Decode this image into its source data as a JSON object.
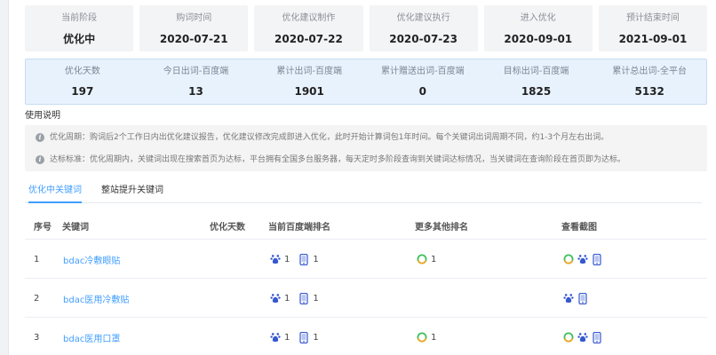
{
  "stages": [
    {
      "label": "当前阶段",
      "value": "优化中"
    },
    {
      "label": "购词时间",
      "value": "2020-07-21"
    },
    {
      "label": "优化建议制作",
      "value": "2020-07-22"
    },
    {
      "label": "优化建议执行",
      "value": "2020-07-23"
    },
    {
      "label": "进入优化",
      "value": "2020-09-01"
    },
    {
      "label": "预计结束时间",
      "value": "2021-09-01"
    }
  ],
  "stats": [
    {
      "label": "优化天数",
      "value": "197"
    },
    {
      "label": "今日出词-百度端",
      "value": "13"
    },
    {
      "label": "累计出词-百度端",
      "value": "1901"
    },
    {
      "label": "累计赠送出词-百度端",
      "value": "0"
    },
    {
      "label": "目标出词-百度端",
      "value": "1825"
    },
    {
      "label": "累计总出词-全平台",
      "value": "5132"
    }
  ],
  "usage": {
    "title": "使用说明",
    "notes": [
      "优化周期：购词后2个工作日内出优化建议报告，优化建议修改完成即进入优化，此时开始计算词包1年时间。每个关键词出词周期不同，约1-3个月左右出词。",
      "达标标准：优化周期内，关键词出现在搜索首页为达标，平台拥有全国多台服务器，每天定时多阶段查询到关键词达标情况，当关键词在查询阶段在首页即为达标。"
    ]
  },
  "tabs": [
    {
      "label": "优化中关键词",
      "active": true
    },
    {
      "label": "整站提升关键词",
      "active": false
    }
  ],
  "table": {
    "headers": [
      "序号",
      "关键词",
      "优化天数",
      "当前百度端排名",
      "更多其他排名",
      "查看截图"
    ],
    "rows": [
      {
        "index": "1",
        "keyword": "bdac冷敷眼贴",
        "days": "",
        "baidu_pc": "1",
        "baidu_mobile": "1",
        "other": "1",
        "has_other": true,
        "shots": [
          "360",
          "baidu",
          "mobile"
        ]
      },
      {
        "index": "2",
        "keyword": "bdac医用冷敷贴",
        "days": "",
        "baidu_pc": "1",
        "baidu_mobile": "1",
        "other": "",
        "has_other": false,
        "shots": [
          "baidu",
          "mobile"
        ]
      },
      {
        "index": "3",
        "keyword": "bdac医用口罩",
        "days": "",
        "baidu_pc": "1",
        "baidu_mobile": "1",
        "other": "1",
        "has_other": true,
        "shots": [
          "360",
          "baidu",
          "mobile"
        ]
      }
    ]
  },
  "colors": {
    "accent": "#409eff",
    "baidu": "#3558d0",
    "ring_green": "#3fbf5a",
    "ring_orange": "#f5a623"
  }
}
